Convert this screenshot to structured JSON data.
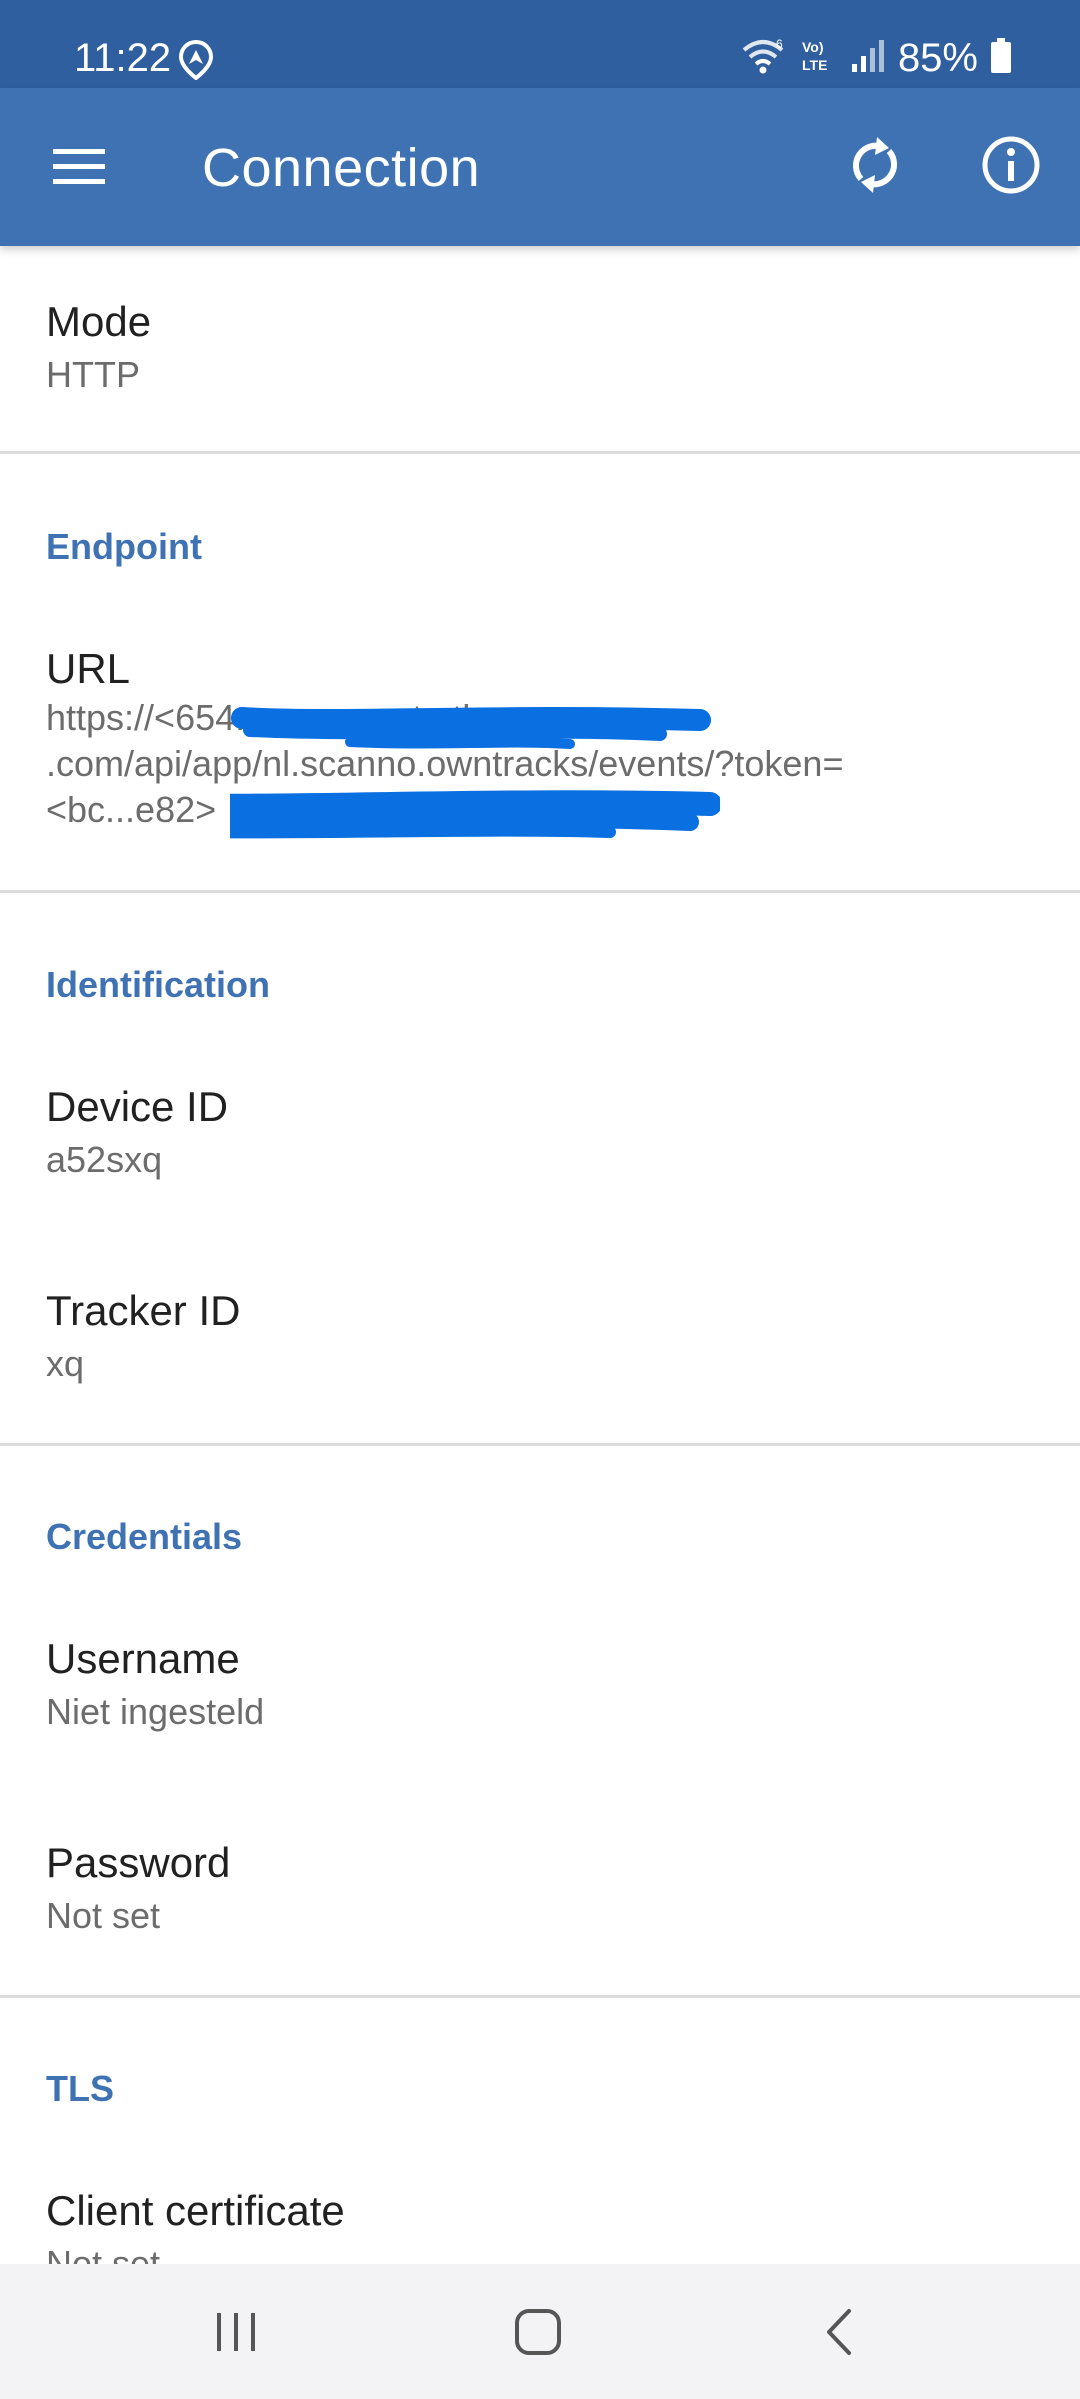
{
  "status_bar": {
    "time": "11:22",
    "battery": "85%",
    "icons": [
      "location-icon",
      "wifi-icon",
      "volte-icon",
      "signal-icon",
      "battery-icon"
    ]
  },
  "app_bar": {
    "title": "Connection",
    "icons": [
      "menu-icon",
      "refresh-icon",
      "info-icon"
    ]
  },
  "preferences": {
    "mode": {
      "title": "Mode",
      "summary": "HTTP"
    },
    "endpoint": {
      "category": "Endpoint",
      "url": {
        "title": "URL",
        "summary": "https://<654...>.connect.athom\n.com/api/app/nl.scanno.owntracks/events/?token=\n<bc...e82>"
      }
    },
    "identification": {
      "category": "Identification",
      "device_id": {
        "title": "Device ID",
        "summary": "a52sxq"
      },
      "tracker_id": {
        "title": "Tracker ID",
        "summary": "xq"
      }
    },
    "credentials": {
      "category": "Credentials",
      "username": {
        "title": "Username",
        "summary": "Niet ingesteld"
      },
      "password": {
        "title": "Password",
        "summary": "Not set"
      }
    },
    "tls": {
      "category": "TLS",
      "client_certificate": {
        "title": "Client certificate",
        "summary": "Not set"
      }
    }
  },
  "colors": {
    "status_bar": "#2f5f9f",
    "app_bar": "#3f72b3",
    "accent": "#3f72b3",
    "redaction": "#0a6fe0",
    "nav_bar": "#f3f3f5"
  },
  "nav_bar": {
    "icons": [
      "recents-icon",
      "home-icon",
      "back-icon"
    ]
  }
}
